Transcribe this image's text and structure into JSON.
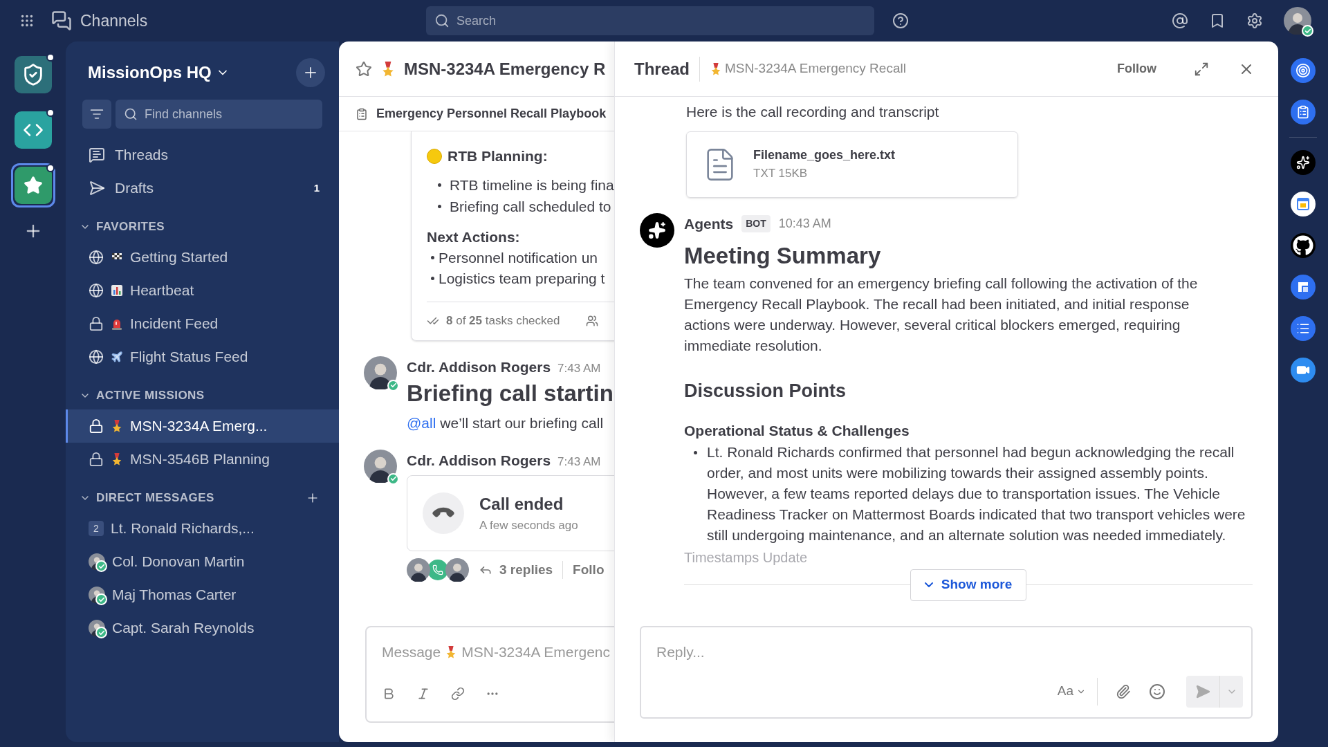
{
  "topbar": {
    "title": "Channels",
    "search_placeholder": "Search"
  },
  "teams": [
    {
      "kind": "shield",
      "selected": false,
      "unread": true
    },
    {
      "kind": "code",
      "selected": false,
      "unread": true
    },
    {
      "kind": "star",
      "selected": true,
      "unread": true
    }
  ],
  "sidebar": {
    "team_name": "MissionOps HQ",
    "find_placeholder": "Find channels",
    "nav": [
      {
        "kind": "threads",
        "label": "Threads"
      },
      {
        "kind": "drafts",
        "label": "Drafts",
        "count": "1"
      }
    ],
    "sections": [
      {
        "title": "FAVORITES",
        "can_add": false,
        "items": [
          {
            "kind": "public",
            "emoji": {
              "kind": "flag"
            },
            "label": "Getting Started",
            "selected": false
          },
          {
            "kind": "public",
            "emoji": {
              "kind": "chart"
            },
            "label": "Heartbeat",
            "selected": false
          },
          {
            "kind": "private",
            "emoji": {
              "kind": "siren"
            },
            "label": "Incident Feed",
            "selected": false
          },
          {
            "kind": "public",
            "emoji": {
              "kind": "plane"
            },
            "label": "Flight Status Feed",
            "selected": false
          }
        ]
      },
      {
        "title": "ACTIVE MISSIONS",
        "can_add": false,
        "items": [
          {
            "kind": "private",
            "emoji": {
              "kind": "medal"
            },
            "label": "MSN-3234A Emerg...",
            "selected": true
          },
          {
            "kind": "private",
            "emoji": {
              "kind": "medal"
            },
            "label": "MSN-3546B Planning",
            "selected": false
          }
        ]
      },
      {
        "title": "DIRECT MESSAGES",
        "can_add": true,
        "items": [
          {
            "kind": "group",
            "count": "2",
            "label": "Lt. Ronald Richards,...",
            "selected": false
          },
          {
            "kind": "user",
            "online": true,
            "label": "Col. Donovan Martin",
            "selected": false
          },
          {
            "kind": "user",
            "online": true,
            "label": "Maj Thomas Carter",
            "selected": false
          },
          {
            "kind": "user",
            "online": true,
            "label": "Capt. Sarah Reynolds",
            "selected": false
          }
        ]
      }
    ]
  },
  "channel": {
    "title": "MSN-3234A Emergency R",
    "playbook": "Emergency Personnel Recall Playbook",
    "card": {
      "heading": "RTB Planning:",
      "bullets": [
        "RTB timeline is being fina",
        "Briefing call scheduled to"
      ],
      "next_heading": "Next Actions:",
      "next_bullets": [
        "Personnel notification un",
        "Logistics team preparing t"
      ],
      "tasks": "**8** of **25** tasks checked"
    },
    "posts": [
      {
        "kind": "message",
        "author": "Cdr. Addison Rogers",
        "time": "7:43 AM",
        "online": true,
        "heading": "Briefing call startin",
        "mention": "@all",
        "text": "we’ll start our briefing call"
      },
      {
        "kind": "call",
        "author": "Cdr. Addison Rogers",
        "time": "7:43 AM",
        "online": true,
        "call_title": "Call ended",
        "call_time": "A few seconds ago",
        "replies": "3 replies",
        "follow": "Follo"
      }
    ],
    "composer": {
      "hint": "Message",
      "hint_channel": "MSN-3234A Emergenc"
    }
  },
  "thread": {
    "title": "Thread",
    "channel": "MSN-3234A Emergency Recall",
    "follow": "Follow",
    "intro": "Here is the call recording and transcript",
    "file": {
      "name": "Filename_goes_here.txt",
      "meta": "TXT 15KB"
    },
    "bot": {
      "name": "Agents",
      "badge": "BOT",
      "time": "10:43 AM",
      "title": "Meeting Summary",
      "summary": "The team convened for an emergency briefing call following the activation of the Emergency Recall Playbook. The recall had been initiated, and initial response actions were underway. However, several critical blockers emerged, requiring immediate resolution.",
      "section": "Discussion Points",
      "subsection": "Operational Status & Challenges",
      "bullets": [
        "Lt. Ronald Richards confirmed that personnel had begun acknowledging the recall order, and most units were mobilizing towards their assigned assembly points. However, a few teams reported delays due to transportation issues. The Vehicle Readiness Tracker on Mattermost Boards indicated that two transport vehicles were still undergoing maintenance, and an alternate solution was needed immediately."
      ],
      "faded": "Timestamps Update",
      "show_more": "Show more"
    },
    "reply_placeholder": "Reply...",
    "format": "Aa"
  },
  "apps": [
    {
      "kind": "target"
    },
    {
      "kind": "clipboard"
    },
    {
      "kind": "sparkle"
    },
    {
      "kind": "calendar"
    },
    {
      "kind": "github"
    },
    {
      "kind": "boards"
    },
    {
      "kind": "list"
    },
    {
      "kind": "video"
    }
  ]
}
